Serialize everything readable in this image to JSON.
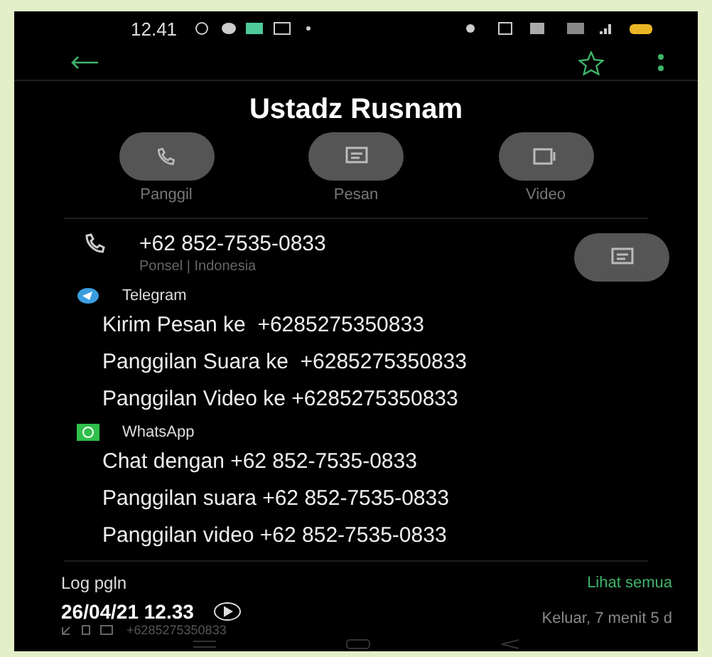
{
  "status_bar": {
    "time": "12.41"
  },
  "contact": {
    "name": "Ustadz Rusnam",
    "starred": false
  },
  "actions": [
    {
      "kind": "call",
      "label": "Panggil"
    },
    {
      "kind": "message",
      "label": "Pesan"
    },
    {
      "kind": "video",
      "label": "Video"
    }
  ],
  "phone": {
    "number": "+62 852-7535-0833",
    "detail": "Ponsel | Indonesia"
  },
  "apps": [
    {
      "kind": "telegram",
      "name": "Telegram",
      "items": [
        "Kirim Pesan ke  +6285275350833",
        "Panggilan Suara ke  +6285275350833",
        "Panggilan Video ke +6285275350833"
      ]
    },
    {
      "kind": "whatsapp",
      "name": "WhatsApp",
      "items": [
        "Chat dengan +62 852-7535-0833",
        "Panggilan suara +62 852-7535-0833",
        "Panggilan video +62 852-7535-0833"
      ]
    }
  ],
  "call_log": {
    "title": "Log pgln",
    "see_all": "Lihat semua",
    "entry": {
      "datetime": "26/04/21 12.33",
      "number": "+6285275350833",
      "summary": "Keluar, 7 menit 5 d"
    }
  }
}
